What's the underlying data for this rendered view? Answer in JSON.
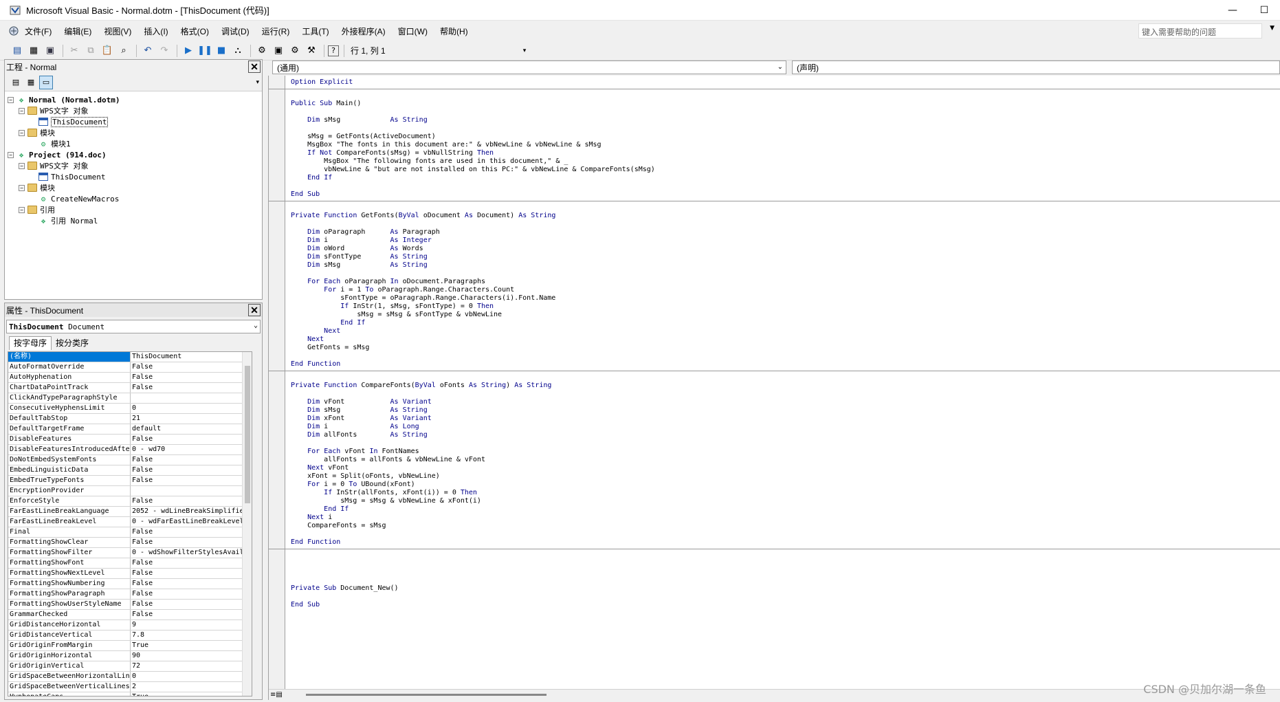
{
  "window": {
    "title": "Microsoft Visual Basic - Normal.dotm - [ThisDocument (代码)]"
  },
  "menu": [
    "文件(F)",
    "编辑(E)",
    "视图(V)",
    "插入(I)",
    "格式(O)",
    "调试(D)",
    "运行(R)",
    "工具(T)",
    "外接程序(A)",
    "窗口(W)",
    "帮助(H)"
  ],
  "help_search": {
    "placeholder": "键入需要帮助的问题"
  },
  "toolbar": {
    "position": "行 1, 列 1"
  },
  "project_panel": {
    "title": "工程 - Normal",
    "tree": [
      {
        "level": 0,
        "label": "Normal (Normal.dotm)",
        "bold": true,
        "exp": "−",
        "icon": "vba-project-icon"
      },
      {
        "level": 1,
        "label": "WPS文字 对象",
        "exp": "−",
        "icon": "folder-icon"
      },
      {
        "level": 2,
        "label": "ThisDocument",
        "icon": "document-icon",
        "selected": true
      },
      {
        "level": 1,
        "label": "模块",
        "exp": "−",
        "icon": "folder-icon"
      },
      {
        "level": 2,
        "label": "模块1",
        "icon": "module-icon"
      },
      {
        "level": 0,
        "label": "Project (914.doc)",
        "bold": true,
        "exp": "−",
        "icon": "vba-project-icon"
      },
      {
        "level": 1,
        "label": "WPS文字 对象",
        "exp": "−",
        "icon": "folder-icon"
      },
      {
        "level": 2,
        "label": "ThisDocument",
        "icon": "document-icon"
      },
      {
        "level": 1,
        "label": "模块",
        "exp": "−",
        "icon": "folder-icon"
      },
      {
        "level": 2,
        "label": "CreateNewMacros",
        "icon": "module-icon"
      },
      {
        "level": 1,
        "label": "引用",
        "exp": "−",
        "icon": "folder-icon"
      },
      {
        "level": 2,
        "label": "引用 Normal",
        "icon": "reference-icon"
      }
    ]
  },
  "properties_panel": {
    "title": "属性 - ThisDocument",
    "object": "ThisDocument",
    "object_type": "Document",
    "tabs": [
      "按字母序",
      "按分类序"
    ],
    "rows": [
      [
        "(名称)",
        "ThisDocument"
      ],
      [
        "AutoFormatOverride",
        "False"
      ],
      [
        "AutoHyphenation",
        "False"
      ],
      [
        "ChartDataPointTrack",
        "False"
      ],
      [
        "ClickAndTypeParagraphStyle",
        ""
      ],
      [
        "ConsecutiveHyphensLimit",
        "0"
      ],
      [
        "DefaultTabStop",
        "21"
      ],
      [
        "DefaultTargetFrame",
        "default"
      ],
      [
        "DisableFeatures",
        "False"
      ],
      [
        "DisableFeaturesIntroducedAfte",
        "0 - wd70"
      ],
      [
        "DoNotEmbedSystemFonts",
        "False"
      ],
      [
        "EmbedLinguisticData",
        "False"
      ],
      [
        "EmbedTrueTypeFonts",
        "False"
      ],
      [
        "EncryptionProvider",
        ""
      ],
      [
        "EnforceStyle",
        "False"
      ],
      [
        "FarEastLineBreakLanguage",
        "2052 - wdLineBreakSimplified"
      ],
      [
        "FarEastLineBreakLevel",
        "0 - wdFarEastLineBreakLevelN"
      ],
      [
        "Final",
        "False"
      ],
      [
        "FormattingShowClear",
        "False"
      ],
      [
        "FormattingShowFilter",
        "0 - wdShowFilterStylesAvaila"
      ],
      [
        "FormattingShowFont",
        "False"
      ],
      [
        "FormattingShowNextLevel",
        "False"
      ],
      [
        "FormattingShowNumbering",
        "False"
      ],
      [
        "FormattingShowParagraph",
        "False"
      ],
      [
        "FormattingShowUserStyleName",
        "False"
      ],
      [
        "GrammarChecked",
        "False"
      ],
      [
        "GridDistanceHorizontal",
        "9"
      ],
      [
        "GridDistanceVertical",
        "7.8"
      ],
      [
        "GridOriginFromMargin",
        "True"
      ],
      [
        "GridOriginHorizontal",
        "90"
      ],
      [
        "GridOriginVertical",
        "72"
      ],
      [
        "GridSpaceBetweenHorizontalLin",
        "0"
      ],
      [
        "GridSpaceBetweenVerticalLines",
        "2"
      ],
      [
        "HyphenateCaps",
        "True"
      ]
    ]
  },
  "code_window": {
    "object_combo": "(通用)",
    "proc_combo": "(声明)",
    "blocks": [
      [
        "Option Explicit"
      ],
      [
        "Public Sub Main()",
        "",
        "    Dim sMsg            As String",
        "",
        "    sMsg = GetFonts(ActiveDocument)",
        "    MsgBox \"The fonts in this document are:\" & vbNewLine & vbNewLine & sMsg",
        "    If Not CompareFonts(sMsg) = vbNullString Then",
        "        MsgBox \"The following fonts are used in this document,\" & _",
        "        vbNewLine & \"but are not installed on this PC:\" & vbNewLine & CompareFonts(sMsg)",
        "    End If",
        "",
        "End Sub"
      ],
      [
        "Private Function GetFonts(ByVal oDocument As Document) As String",
        "",
        "    Dim oParagraph      As Paragraph",
        "    Dim i               As Integer",
        "    Dim oWord           As Words",
        "    Dim sFontType       As String",
        "    Dim sMsg            As String",
        "",
        "    For Each oParagraph In oDocument.Paragraphs",
        "        For i = 1 To oParagraph.Range.Characters.Count",
        "            sFontType = oParagraph.Range.Characters(i).Font.Name",
        "            If InStr(1, sMsg, sFontType) = 0 Then",
        "                sMsg = sMsg & sFontType & vbNewLine",
        "            End If",
        "        Next",
        "    Next",
        "    GetFonts = sMsg",
        "",
        "End Function"
      ],
      [
        "Private Function CompareFonts(ByVal oFonts As String) As String",
        "",
        "    Dim vFont           As Variant",
        "    Dim sMsg            As String",
        "    Dim xFont           As Variant",
        "    Dim i               As Long",
        "    Dim allFonts        As String",
        "",
        "    For Each vFont In FontNames",
        "        allFonts = allFonts & vbNewLine & vFont",
        "    Next vFont",
        "    xFont = Split(oFonts, vbNewLine)",
        "    For i = 0 To UBound(xFont)",
        "        If InStr(allFonts, xFont(i)) = 0 Then",
        "            sMsg = sMsg & vbNewLine & xFont(i)",
        "        End If",
        "    Next i",
        "    CompareFonts = sMsg",
        "",
        "End Function"
      ],
      [
        "",
        "",
        "",
        "Private Sub Document_New()",
        "",
        "End Sub"
      ]
    ]
  },
  "watermark": "CSDN @贝加尔湖一条鱼"
}
